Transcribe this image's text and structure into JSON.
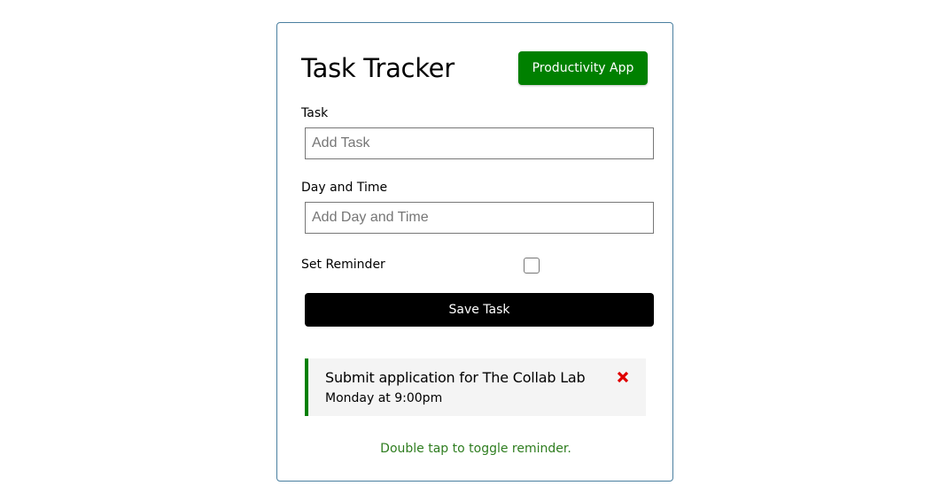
{
  "header": {
    "title": "Task Tracker",
    "app_badge_label": "Productivity App"
  },
  "form": {
    "task_label": "Task",
    "task_placeholder": "Add Task",
    "task_value": "",
    "day_label": "Day and Time",
    "day_placeholder": "Add Day and Time",
    "day_value": "",
    "reminder_label": "Set Reminder",
    "reminder_checked": false,
    "save_label": "Save Task"
  },
  "tasks": [
    {
      "title": "Submit application for The Collab Lab",
      "day": "Monday at 9:00pm",
      "reminder": true,
      "delete_icon": "close-icon"
    }
  ],
  "footer": {
    "hint": "Double tap to toggle reminder."
  },
  "colors": {
    "accent_green": "#008000",
    "delete_red": "#e00000",
    "hint_green": "#2e7d1f",
    "card_border": "#4a7fa0"
  }
}
